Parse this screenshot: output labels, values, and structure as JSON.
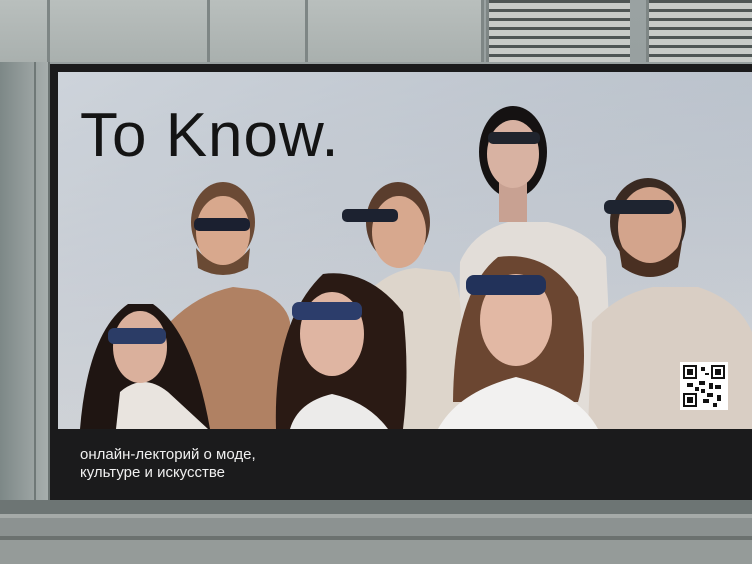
{
  "billboard": {
    "headline": "To Know.",
    "caption_line1": "онлайн-лекторий о моде,",
    "caption_line2": "культуре и искусстве"
  },
  "icons": {
    "qr": "qr-code-icon"
  },
  "colors": {
    "board": "#1b1b1c",
    "sky": "#c2c8d0",
    "headline": "#141414",
    "caption": "#f0f0f0"
  }
}
